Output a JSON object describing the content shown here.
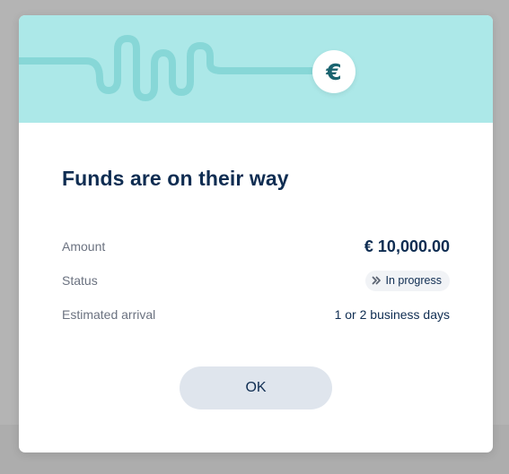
{
  "modal": {
    "title": "Funds are on their way",
    "hero_icon": "euro-icon",
    "hero_symbol": "€",
    "colors": {
      "hero_background": "#ace8e8",
      "wave_line": "#87d7d7",
      "badge_symbol": "#1a6470",
      "title_text": "#0f2d52",
      "button_background": "#dfe5ed"
    },
    "details": {
      "amount": {
        "label": "Amount",
        "value": "€ 10,000.00"
      },
      "status": {
        "label": "Status",
        "value": "In progress",
        "icon": "chevrons-right-icon"
      },
      "arrival": {
        "label": "Estimated arrival",
        "value": "1 or 2 business days"
      }
    },
    "ok_label": "OK"
  }
}
